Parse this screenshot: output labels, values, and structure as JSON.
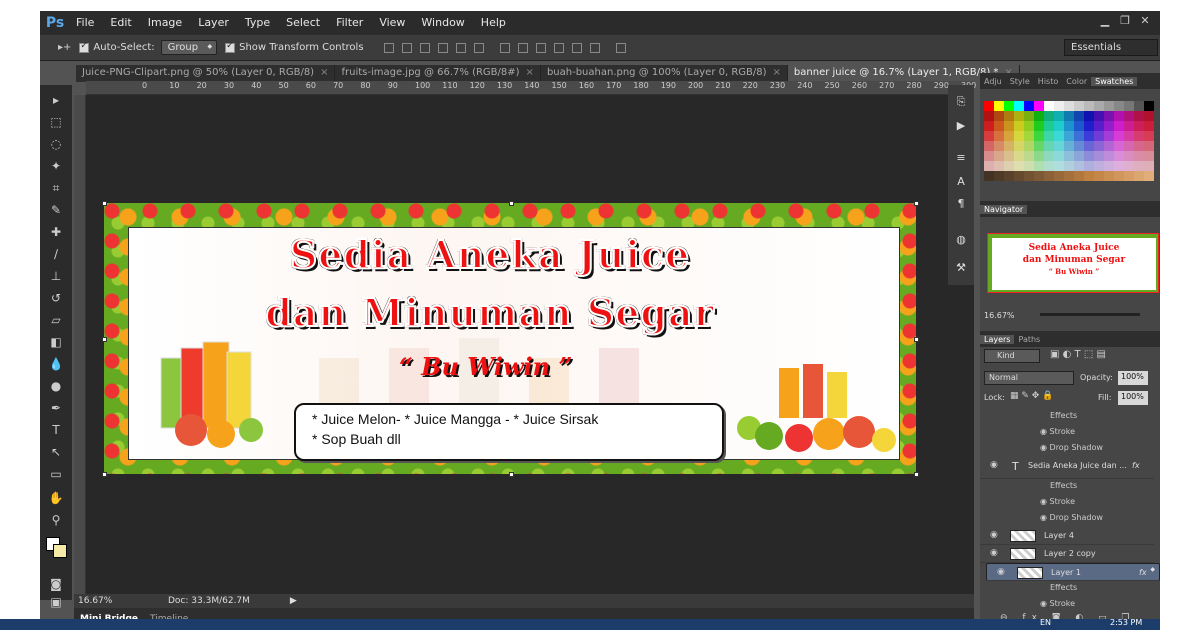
{
  "app": {
    "logo": "Ps"
  },
  "menu": [
    "File",
    "Edit",
    "Image",
    "Layer",
    "Type",
    "Select",
    "Filter",
    "View",
    "Window",
    "Help"
  ],
  "options": {
    "auto_select_label": "Auto-Select:",
    "auto_select_value": "Group",
    "transform_label": "Show Transform Controls",
    "workspace": "Essentials"
  },
  "tabs": [
    {
      "label": "Juice-PNG-Clipart.png @ 50% (Layer 0, RGB/8)",
      "active": false
    },
    {
      "label": "fruits-image.jpg @ 66.7% (RGB/8#)",
      "active": false
    },
    {
      "label": "buah-buahan.png @ 100% (Layer 0, RGB/8)",
      "active": false
    },
    {
      "label": "banner juice @ 16.7% (Layer 1, RGB/8) *",
      "active": true
    }
  ],
  "ruler": [
    "0",
    "10",
    "20",
    "30",
    "40",
    "50",
    "60",
    "70",
    "80",
    "90",
    "100",
    "110",
    "120",
    "130",
    "140",
    "150",
    "160",
    "170",
    "180",
    "190",
    "200",
    "210",
    "220",
    "230",
    "240",
    "250",
    "260",
    "270",
    "280",
    "290",
    "300"
  ],
  "banner": {
    "title_line1": "Sedia Aneka Juice",
    "title_line2": "dan Minuman Segar",
    "subtitle": "“ Bu Wiwin ”",
    "info_line1": "* Juice Melon- * Juice Mangga - * Juice Sirsak",
    "info_line2": "* Sop Buah dll"
  },
  "status": {
    "zoom": "16.67%",
    "doc": "Doc: 33.3M/62.7M"
  },
  "bottom_tabs": [
    "Mini Bridge",
    "Timeline"
  ],
  "swatch_tabs": [
    "Adju",
    "Style",
    "Histo",
    "Color",
    "Swatches"
  ],
  "navigator": {
    "title": "Navigator",
    "thumb_line1": "Sedia Aneka Juice",
    "thumb_line2": "dan Minuman Segar",
    "thumb_line3": "“ Bu Wiwin ”",
    "zoom": "16.67%"
  },
  "layers_panel": {
    "tabs": [
      "Layers",
      "Paths"
    ],
    "kind": "Kind",
    "blend": "Normal",
    "opacity_label": "Opacity:",
    "opacity": "100%",
    "lock_label": "Lock:",
    "fill_label": "Fill:",
    "fill": "100%",
    "rows": [
      {
        "type": "sub",
        "label": "Effects"
      },
      {
        "type": "sub2",
        "label": "Stroke"
      },
      {
        "type": "sub2",
        "label": "Drop Shadow"
      },
      {
        "type": "layer",
        "label": "Sedia Aneka Juice dan ...",
        "kind": "T"
      },
      {
        "type": "sub",
        "label": "Effects"
      },
      {
        "type": "sub2",
        "label": "Stroke"
      },
      {
        "type": "sub2",
        "label": "Drop Shadow"
      },
      {
        "type": "layer",
        "label": "Layer 4"
      },
      {
        "type": "layer",
        "label": "Layer 2 copy"
      },
      {
        "type": "layer",
        "label": "Layer 1",
        "selected": true
      },
      {
        "type": "sub",
        "label": "Effects"
      },
      {
        "type": "sub2",
        "label": "Stroke"
      }
    ]
  },
  "taskbar": {
    "time": "2:53 PM",
    "lang": "EN"
  },
  "colors": {
    "accent_red": "#e11111",
    "panel": "#464646",
    "canvas_bg": "#282828"
  }
}
